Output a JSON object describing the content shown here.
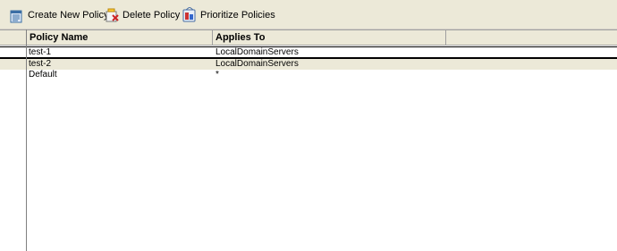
{
  "toolbar": {
    "create_label": "Create New Policy",
    "delete_label": "Delete Policy",
    "prioritize_label": "Prioritize Policies"
  },
  "table": {
    "columns": [
      "Policy Name",
      "Applies To",
      ""
    ],
    "rows": [
      {
        "name": "test-1",
        "applies_to": "LocalDomainServers",
        "selected": true
      },
      {
        "name": "test-2",
        "applies_to": "LocalDomainServers",
        "selected": false
      },
      {
        "name": "Default",
        "applies_to": "*",
        "selected": false
      }
    ]
  },
  "icons": {
    "create": "new-policy-icon",
    "delete": "delete-policy-icon",
    "prioritize": "prioritize-policies-icon"
  },
  "colors": {
    "toolbar_bg": "#ece9d8",
    "header_bg": "#ece9d8",
    "alt_row_bg": "#ece9d8"
  }
}
